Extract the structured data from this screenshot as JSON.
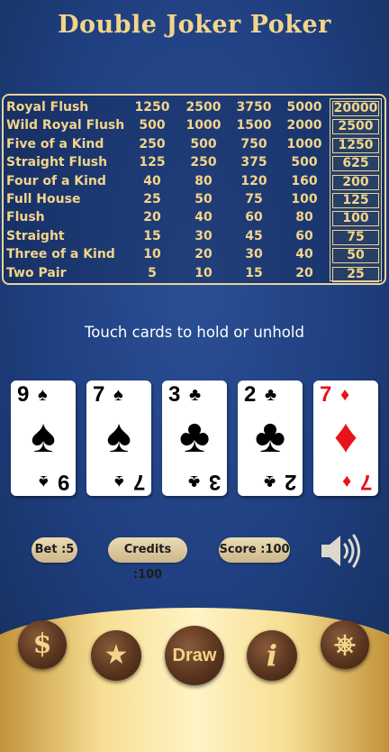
{
  "title": "Double Joker Poker",
  "paytable": {
    "rows": [
      {
        "name": "Royal Flush",
        "values": [
          "1250",
          "2500",
          "3750",
          "5000"
        ],
        "max": "20000"
      },
      {
        "name": "Wild Royal Flush",
        "values": [
          "500",
          "1000",
          "1500",
          "2000"
        ],
        "max": "2500"
      },
      {
        "name": "Five of a Kind",
        "values": [
          "250",
          "500",
          "750",
          "1000"
        ],
        "max": "1250"
      },
      {
        "name": "Straight Flush",
        "values": [
          "125",
          "250",
          "375",
          "500"
        ],
        "max": "625"
      },
      {
        "name": "Four of a Kind",
        "values": [
          "40",
          "80",
          "120",
          "160"
        ],
        "max": "200"
      },
      {
        "name": "Full House",
        "values": [
          "25",
          "50",
          "75",
          "100"
        ],
        "max": "125"
      },
      {
        "name": "Flush",
        "values": [
          "20",
          "40",
          "60",
          "80"
        ],
        "max": "100"
      },
      {
        "name": "Straight",
        "values": [
          "15",
          "30",
          "45",
          "60"
        ],
        "max": "75"
      },
      {
        "name": "Three of a Kind",
        "values": [
          "10",
          "20",
          "30",
          "40"
        ],
        "max": "50"
      },
      {
        "name": "Two Pair",
        "values": [
          "5",
          "10",
          "15",
          "20"
        ],
        "max": "25"
      }
    ]
  },
  "instruction": "Touch cards to hold or unhold",
  "cards": [
    {
      "rank": "9",
      "suit": "♠",
      "color": "black"
    },
    {
      "rank": "7",
      "suit": "♠",
      "color": "black"
    },
    {
      "rank": "3",
      "suit": "♣",
      "color": "black"
    },
    {
      "rank": "2",
      "suit": "♣",
      "color": "black"
    },
    {
      "rank": "7",
      "suit": "♦",
      "color": "red"
    }
  ],
  "status": {
    "bet": "Bet :5",
    "credits": "Credits :100",
    "score": "Score :100"
  },
  "buttons": {
    "coin_icon": "$",
    "star_icon": "★",
    "draw": "Draw",
    "info_icon": "i",
    "settings_icon": "⎈"
  },
  "icons": {
    "speaker": "speaker-icon"
  },
  "colors": {
    "gold_text": "#f3d58a",
    "background": "#1f3f80",
    "red_suit": "#e8131a"
  }
}
